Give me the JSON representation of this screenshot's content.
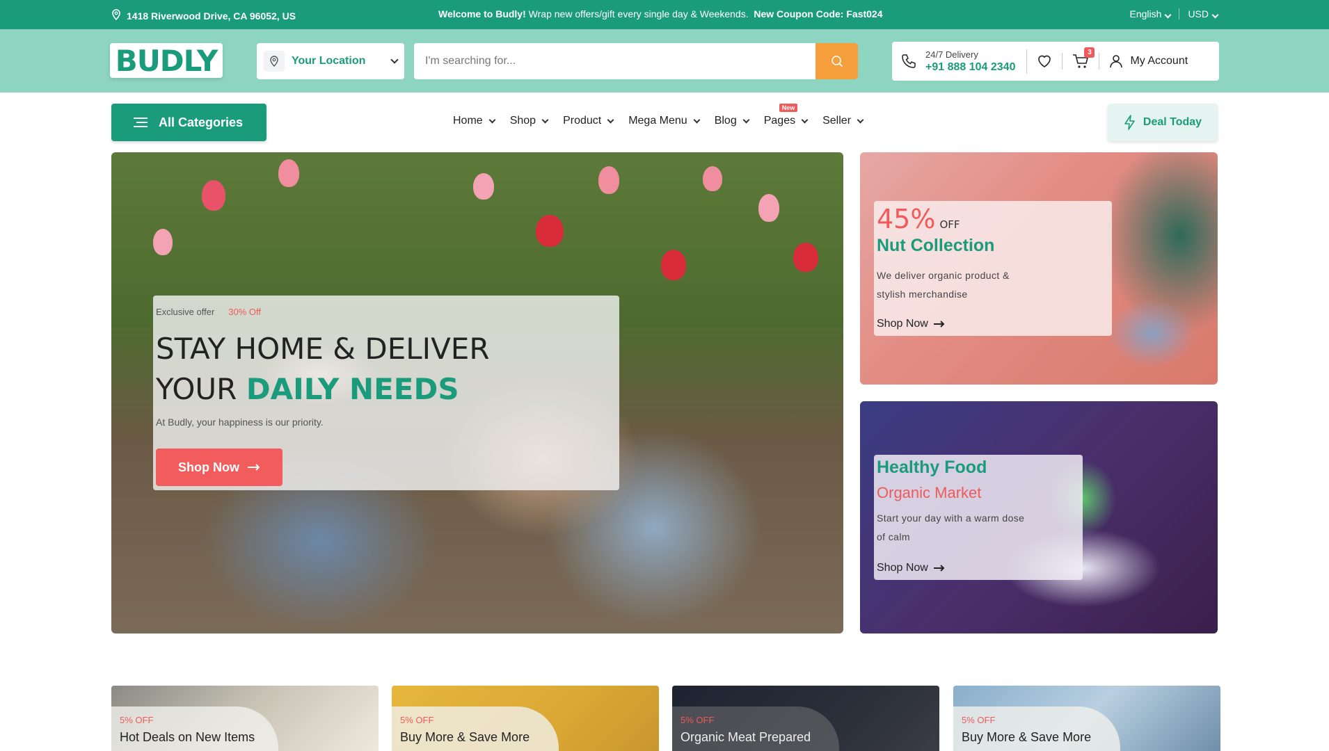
{
  "topbar": {
    "address": "1418 Riverwood Drive, CA 96052, US",
    "promo_welcome": "Welcome to Budly!",
    "promo_text": "Wrap new offers/gift every single day & Weekends.",
    "promo_coupon": "New Coupon Code: Fast024",
    "language": "English",
    "currency": "USD"
  },
  "header": {
    "logo": "BUDLY",
    "location_label": "Your Location",
    "search_placeholder": "I'm searching for...",
    "delivery_label": "24/7 Delivery",
    "delivery_phone": "+91 888 104 2340",
    "cart_count": "3",
    "account_label": "My Account"
  },
  "nav": {
    "all_categories": "All Categories",
    "items": [
      {
        "label": "Home"
      },
      {
        "label": "Shop"
      },
      {
        "label": "Product"
      },
      {
        "label": "Mega Menu"
      },
      {
        "label": "Blog"
      },
      {
        "label": "Pages",
        "badge": "New"
      },
      {
        "label": "Seller"
      }
    ],
    "deal_today": "Deal Today"
  },
  "hero": {
    "tag": "Exclusive offer",
    "tag_off": "30% Off",
    "headline_line1": "STAY HOME & DELIVER",
    "headline_line2_a": "YOUR ",
    "headline_line2_b": "DAILY NEEDS",
    "subtitle": "At Budly, your happiness is our priority.",
    "button": "Shop Now"
  },
  "banners": [
    {
      "percent": "45%",
      "off": "OFF",
      "title": "Nut Collection",
      "desc": "We deliver organic product & stylish merchandise",
      "link": "Shop Now"
    },
    {
      "title": "Healthy Food",
      "subtitle": "Organic Market",
      "desc": "Start your day with a warm dose of calm",
      "link": "Shop Now"
    }
  ],
  "promo_cards": [
    {
      "off": "5% OFF",
      "title": "Hot Deals on New Items"
    },
    {
      "off": "5% OFF",
      "title": "Buy More & Save More"
    },
    {
      "off": "5% OFF",
      "title": "Organic Meat Prepared"
    },
    {
      "off": "5% OFF",
      "title": "Buy More & Save More"
    }
  ],
  "colors": {
    "brand": "#1a9b7b",
    "header_bg": "#8dd5c0",
    "accent_red": "#ef5a5a",
    "search_button": "#f59f3c"
  }
}
